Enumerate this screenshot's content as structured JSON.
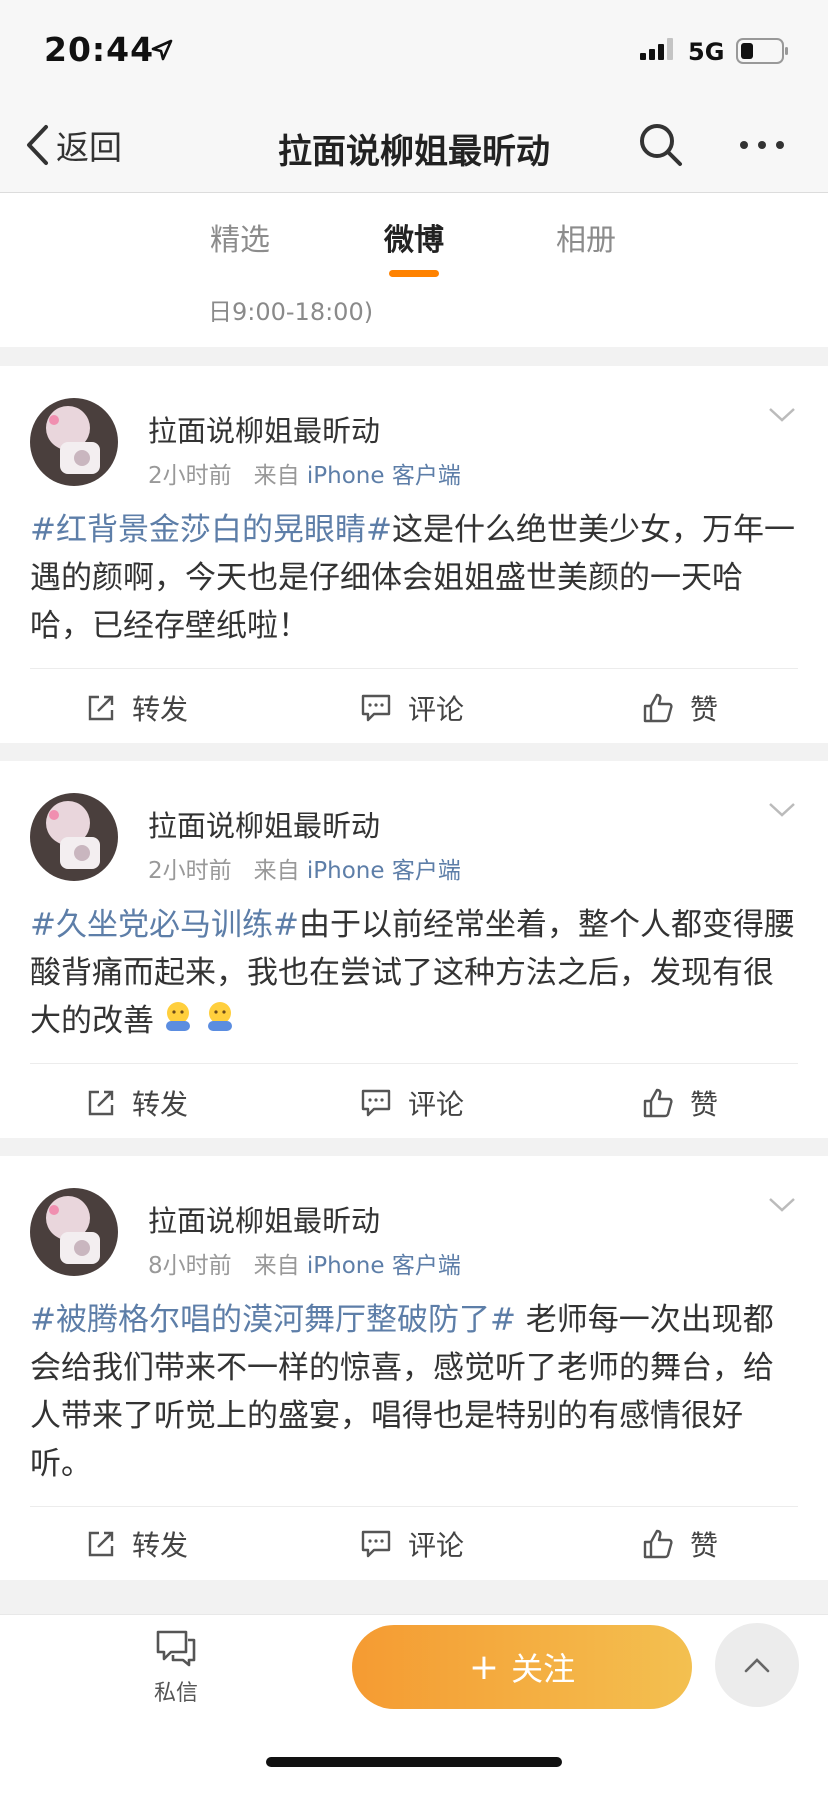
{
  "status_bar": {
    "time": "20:44",
    "network": "5G"
  },
  "nav": {
    "back_label": "返回",
    "title": "拉面说柳姐最昕动"
  },
  "tabs": [
    {
      "label": "精选",
      "active": false
    },
    {
      "label": "微博",
      "active": true
    },
    {
      "label": "相册",
      "active": false
    }
  ],
  "top_info_text": "日9:00-18:00)",
  "posts": [
    {
      "author": "拉面说柳姐最昕动",
      "time": "2小时前",
      "from_label": "来自",
      "source": "iPhone 客户端",
      "hashtag": "#红背景金莎白的晃眼睛#",
      "body": "这是什么绝世美少女，万年一遇的颜啊，今天也是仔细体会姐姐盛世美颜的一天哈哈，已经存壁纸啦！",
      "emoji_count": 0
    },
    {
      "author": "拉面说柳姐最昕动",
      "time": "2小时前",
      "from_label": "来自",
      "source": "iPhone 客户端",
      "hashtag": "#久坐党必马训练#",
      "body": "由于以前经常坐着，整个人都变得腰酸背痛而起来，我也在尝试了这种方法之后，发现有很大的改善",
      "emoji_count": 2
    },
    {
      "author": "拉面说柳姐最昕动",
      "time": "8小时前",
      "from_label": "来自",
      "source": "iPhone 客户端",
      "hashtag": "#被腾格尔唱的漠河舞厅整破防了#",
      "body": " 老师每一次出现都会给我们带来不一样的惊喜，感觉听了老师的舞台，给人带来了听觉上的盛宴，唱得也是特别的有感情很好听。",
      "emoji_count": 0
    }
  ],
  "actions": {
    "repost": "转发",
    "comment": "评论",
    "like": "赞"
  },
  "bottom": {
    "dm_label": "私信",
    "follow_label": "关注",
    "follow_plus": "+"
  },
  "colors": {
    "accent": "#ff8200",
    "link": "#5d7ea8",
    "follow_start": "#f59b32",
    "follow_end": "#f3c050"
  },
  "icons": [
    "location-arrow-icon",
    "signal-icon",
    "battery-icon",
    "back-chevron-icon",
    "search-icon",
    "more-icon",
    "chevron-down-icon",
    "repost-icon",
    "comment-icon",
    "like-icon",
    "message-icon",
    "arrow-up-icon"
  ]
}
